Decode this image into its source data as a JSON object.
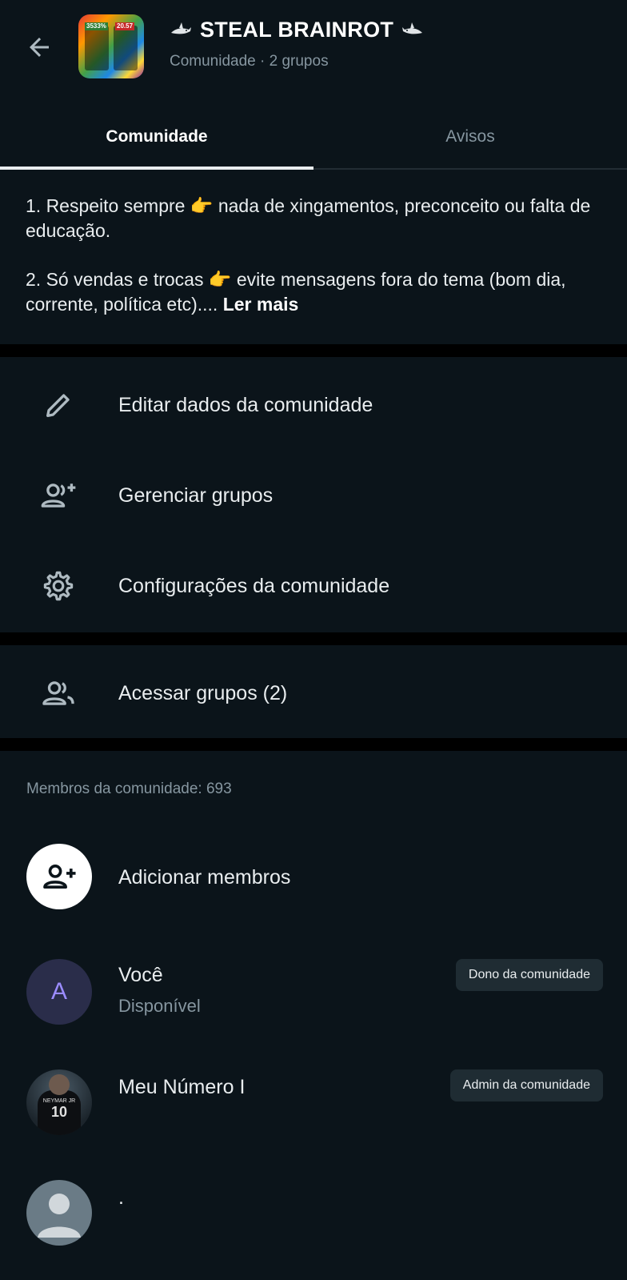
{
  "header": {
    "title": "STEAL BRAINROT",
    "subtitle": "Comunidade · 2 grupos",
    "avatar_badges": [
      "3533%",
      "20.57"
    ]
  },
  "tabs": [
    {
      "label": "Comunidade",
      "active": true
    },
    {
      "label": "Avisos",
      "active": false
    }
  ],
  "description": {
    "rule1": "1. Respeito sempre 👉 nada de xingamentos, preconceito ou falta de educação.",
    "rule2": "2. Só vendas e trocas 👉 evite mensagens fora do tema (bom dia, corrente, política etc)....",
    "more_label": "Ler mais"
  },
  "menu": {
    "edit": {
      "label": "Editar dados da comunidade",
      "icon": "pencil-icon"
    },
    "manage": {
      "label": "Gerenciar grupos",
      "icon": "group-add-icon"
    },
    "settings": {
      "label": "Configurações da comunidade",
      "icon": "gear-icon"
    },
    "access": {
      "label": "Acessar grupos (2)",
      "icon": "groups-icon"
    }
  },
  "members": {
    "count_label": "Membros da comunidade: 693",
    "add_label": "Adicionar membros",
    "list": [
      {
        "name": "Você",
        "status": "Disponível",
        "badge": "Dono da comunidade",
        "initial": "A"
      },
      {
        "name": "Meu Número I",
        "status": "",
        "badge": "Admin da comunidade",
        "jersey_text": "NEYMAR JR",
        "jersey_number": "10"
      },
      {
        "name": ".",
        "status": "",
        "badge": ""
      }
    ]
  },
  "colors": {
    "background": "#0b141a",
    "secondary_text": "#8696a0",
    "badge_bg": "#1f2c33",
    "avatar_A_bg": "#2a2d4a",
    "avatar_A_text": "#9b8cff"
  }
}
